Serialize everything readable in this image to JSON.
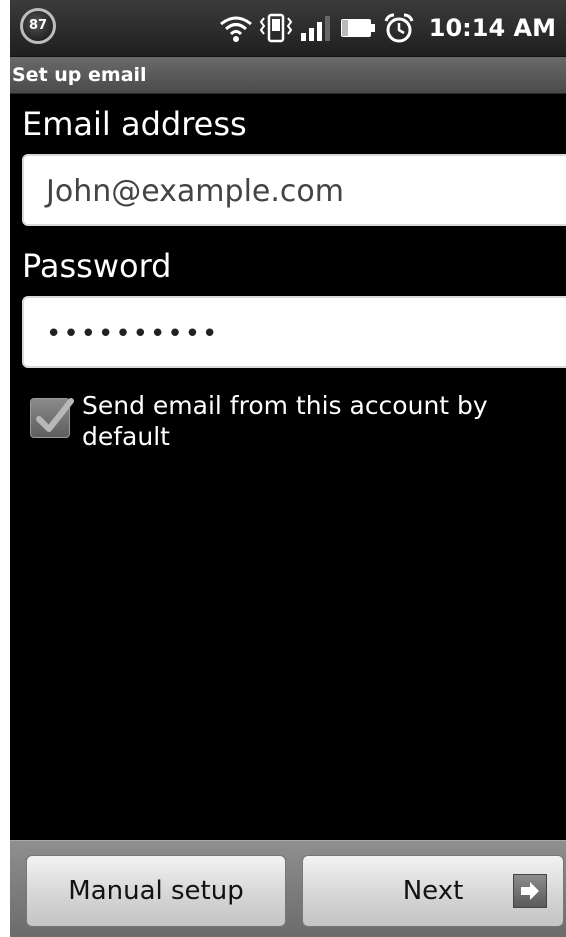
{
  "status_bar": {
    "battery_level": "87",
    "time": "10:14 AM",
    "icons": [
      "wifi-icon",
      "vibrate-icon",
      "signal-icon",
      "battery-icon",
      "alarm-icon"
    ]
  },
  "header": {
    "title": "Set up email"
  },
  "form": {
    "email_label": "Email address",
    "email_value": "John@example.com",
    "password_label": "Password",
    "password_value": "••••••••••",
    "default_checkbox": {
      "label": "Send email from this account by default",
      "checked": true
    }
  },
  "buttons": {
    "manual_setup": "Manual setup",
    "next": "Next"
  },
  "colors": {
    "background": "#000000",
    "text": "#ffffff",
    "field_background": "#ffffff"
  }
}
